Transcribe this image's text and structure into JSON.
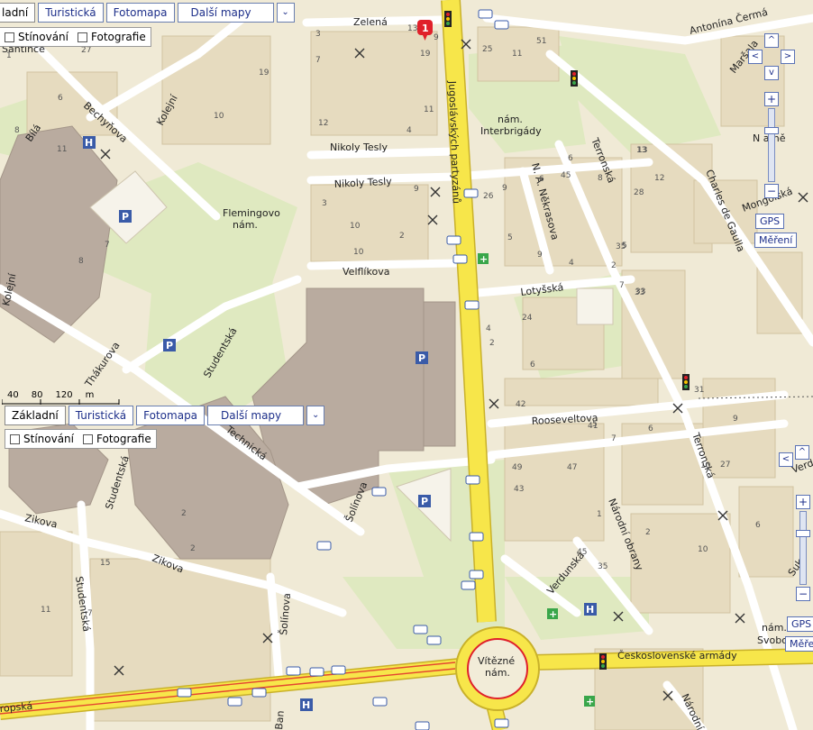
{
  "map": {
    "streets": {
      "zelena": "Zelená",
      "antonina_cermaka": "Antonína Čermá",
      "jugoslavskych_partyzanu": "Jugoslávských partyzánů",
      "nam_interbrigady_1": "nám.",
      "nam_interbrigady_2": "Interbrigády",
      "nikoly_tesly_1": "Nikoly Tesly",
      "nikoly_tesly_2": "Nikoly Tesly",
      "flemingovo_1": "Flemingovo",
      "flemingovo_2": "nám.",
      "velflikova": "Velflíkova",
      "bechynova": "Bechyňova",
      "kolejni_top": "Kolejní",
      "kolejni_left": "Kolejní",
      "bila": "Bílá",
      "santince": "Santince",
      "nakrasova": "N. A. Někrasova",
      "terronska_top": "Terronská",
      "terronska_bottom": "Terronská",
      "charles_de_gaulla": "Charles de Gaulla",
      "lotysska": "Lotyšská",
      "rooseveltova": "Rooseveltova",
      "thakurova": "Thákurova",
      "studentska_top": "Studentská",
      "studentska_mid": "Studentská",
      "studentska_bottom": "Studentská",
      "technicka": "Technická",
      "zikova_left": "Zikova",
      "zikova_mid": "Zikova",
      "solinova_top": "Šolínova",
      "solinova_bottom": "Šolínova",
      "verdunska": "Verdunská",
      "narodni_obrany_top": "Národní obrany",
      "narodni_obrany_bottom": "Národní obr",
      "vitezne_nam_1": "Vítězné",
      "vitezne_nam_2": "nám.",
      "ceskoslovenske_armady": "Československé armády",
      "evropska": "ropská",
      "nam_svobody_1": "nám.",
      "nam_svobody_2": "Svobod",
      "n_arne": "N arně",
      "marsala": "Maršala",
      "mongolska": "Mongolská",
      "verdunska_right": "Verdu",
      "suk": "Suk",
      "ban": "Ban"
    },
    "house_numbers": [
      "1",
      "13",
      "9",
      "19",
      "27",
      "25",
      "11",
      "51",
      "3",
      "7",
      "19",
      "10",
      "11",
      "4",
      "8",
      "11",
      "6",
      "12",
      "10",
      "9",
      "26",
      "9",
      "6",
      "45",
      "8",
      "13",
      "6",
      "28",
      "5",
      "3",
      "10",
      "2",
      "4",
      "35",
      "2",
      "8",
      "7",
      "9",
      "5",
      "7",
      "33",
      "4",
      "2",
      "24",
      "6",
      "42",
      "7",
      "5",
      "31",
      "10",
      "6",
      "41",
      "49",
      "43",
      "47",
      "45",
      "1",
      "2",
      "2",
      "15",
      "2",
      "11",
      "7",
      "35",
      "9",
      "27",
      "6",
      "10",
      "33",
      "13",
      "12"
    ],
    "marker_number": "1"
  },
  "controls_top": {
    "zakladni": "ladní",
    "turisticka": "Turistická",
    "fotomapa": "Fotomapa",
    "dalsi_mapy": "Další mapy",
    "stinovani": "Stínování",
    "fotografie": "Fotografie"
  },
  "controls_mid": {
    "zakladni": "Základní",
    "turisticka": "Turistická",
    "fotomapa": "Fotomapa",
    "dalsi_mapy": "Další mapy",
    "stinovani": "Stínování",
    "fotografie": "Fotografie"
  },
  "scale": {
    "t40": "40",
    "t80": "80",
    "t120": "120",
    "unit": "m"
  },
  "right_controls": {
    "gps": "GPS",
    "mereni": "Měření",
    "gps_lower": "GPS",
    "mereni_lower": "Měře"
  },
  "icons": {
    "parking": "P",
    "hospital": "H",
    "tram": "🚋",
    "pharmacy": "+"
  },
  "colors": {
    "main_road": "#f7e64a",
    "main_road_edge": "#c9b12a",
    "roundabout": "#e0202a",
    "building": "#e8dcc0",
    "large_building": "#b8aaa0",
    "green": "#dfe9c0",
    "marker": "#e0202a"
  }
}
